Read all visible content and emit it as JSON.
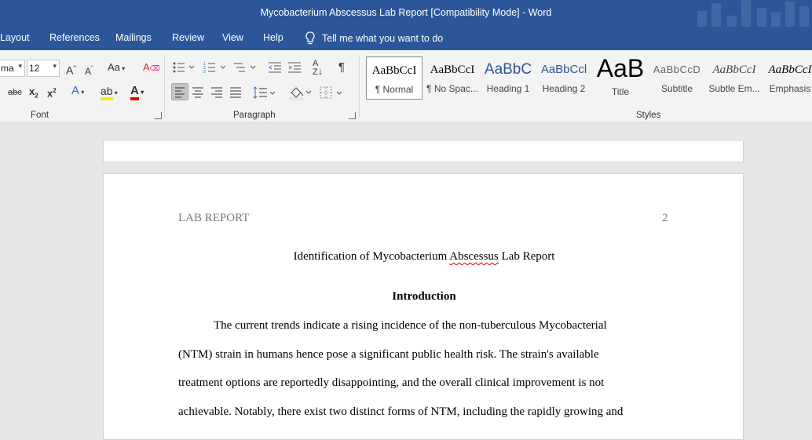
{
  "window": {
    "title": "Mycobacterium Abscessus Lab Report [Compatibility Mode]  -  Word"
  },
  "menu": {
    "tabs": [
      "Layout",
      "References",
      "Mailings",
      "Review",
      "View",
      "Help"
    ],
    "tell_me": "Tell me what you want to do"
  },
  "ribbon": {
    "font": {
      "group_label": "Font",
      "font_name": "ma",
      "font_size": "12"
    },
    "paragraph": {
      "group_label": "Paragraph"
    },
    "styles": {
      "group_label": "Styles",
      "items": [
        {
          "preview": "AaBbCcI",
          "label": "¶ Normal"
        },
        {
          "preview": "AaBbCcI",
          "label": "¶ No Spac..."
        },
        {
          "preview": "AaBbC",
          "label": "Heading 1"
        },
        {
          "preview": "AaBbCcl",
          "label": "Heading 2"
        },
        {
          "preview": "AaB",
          "label": "Title"
        },
        {
          "preview": "AaBbCcD",
          "label": "Subtitle"
        },
        {
          "preview": "AaBbCcI",
          "label": "Subtle Em..."
        },
        {
          "preview": "AaBbCcI",
          "label": "Emphasis"
        }
      ]
    }
  },
  "document": {
    "header_left": "LAB REPORT",
    "page_number": "2",
    "title_before": "Identification of Mycobacterium ",
    "title_flagged": "Abscessus",
    "title_after": " Lab Report",
    "heading": "Introduction",
    "lines": [
      "The current trends indicate a rising incidence of the non-tuberculous Mycobacterial",
      "(NTM) strain in humans hence pose a significant public health risk. The strain's available",
      "treatment options are reportedly disappointing, and the overall clinical improvement is not",
      "achievable. Notably, there exist two distinct forms of NTM, including the rapidly growing and"
    ]
  }
}
